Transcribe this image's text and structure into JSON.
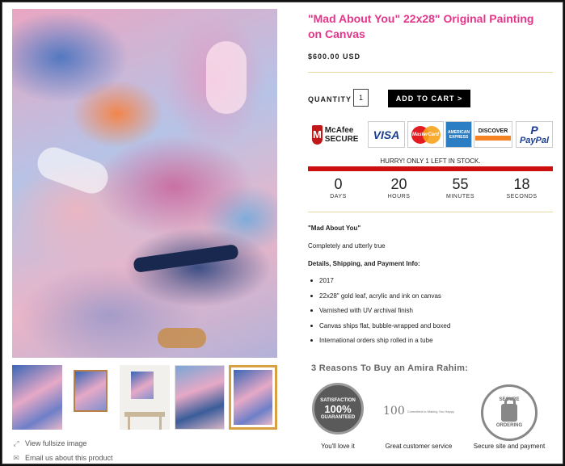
{
  "product": {
    "title": "\"Mad About You\" 22x28\" Original Painting on Canvas",
    "price": "$600.00 USD"
  },
  "purchase": {
    "quantity_label": "QUANTITY",
    "quantity_value": "1",
    "add_to_cart_label": "ADD TO CART >"
  },
  "trust_badges": {
    "mcafee": "McAfee SECURE",
    "visa": "VISA",
    "mastercard": "MasterCard",
    "amex": "AMERICAN EXPRESS",
    "discover": "DISCOVER",
    "paypal": "PayPal"
  },
  "stock": {
    "hurry_text": "HURRY! ONLY 1 LEFT IN STOCK."
  },
  "countdown": [
    {
      "value": "0",
      "label": "DAYS"
    },
    {
      "value": "20",
      "label": "HOURS"
    },
    {
      "value": "55",
      "label": "MINUTES"
    },
    {
      "value": "18",
      "label": "SECONDS"
    }
  ],
  "description": {
    "heading": "\"Mad About You\"",
    "tagline": "Completely and utterly true",
    "details_heading": "Details, Shipping, and Payment Info:",
    "bullets": [
      "2017",
      "22x28\" gold leaf, acrylic and ink on canvas",
      "Varnished with UV archival finish",
      "Canvas ships flat, bubble-wrapped and boxed",
      "International orders ship rolled in a tube"
    ]
  },
  "reasons": {
    "title": "3 Reasons To Buy an Amira Rahim:",
    "items": [
      {
        "caption": "You'll love it",
        "emblem_top": "SATISFACTION",
        "emblem_mid": "100%",
        "emblem_bottom": "GUARANTEED"
      },
      {
        "caption": "Great customer service",
        "emblem_top": "100",
        "emblem_mid": "Committed to Making You Happy"
      },
      {
        "caption": "Secure site and payment",
        "emblem_top": "SECURE",
        "emblem_bottom": "ORDERING"
      }
    ]
  },
  "links": {
    "view_fullsize": "View fullsize image",
    "email_us": "Email us about this product"
  },
  "icons": {
    "expand": "expand-icon",
    "email": "envelope-icon"
  },
  "colors": {
    "title": "#e5358a",
    "stock_bar": "#cc1010",
    "cart_button": "#000000"
  }
}
